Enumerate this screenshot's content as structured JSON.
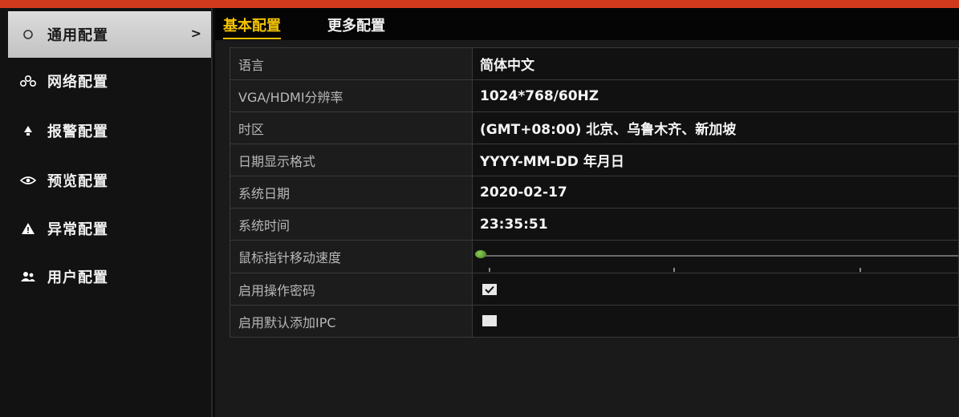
{
  "colors": {
    "accent": "#f2c200",
    "top_bar": "#d23a1e",
    "slider_knob": "#6cbf3a"
  },
  "sidebar": {
    "items": [
      {
        "label": "通用配置",
        "icon": "circle-icon",
        "active": true,
        "chevron": ">"
      },
      {
        "label": "网络配置",
        "icon": "network-icon"
      },
      {
        "label": "报警配置",
        "icon": "alarm-icon"
      },
      {
        "label": "预览配置",
        "icon": "eye-icon"
      },
      {
        "label": "异常配置",
        "icon": "warning-icon"
      },
      {
        "label": "用户配置",
        "icon": "users-icon"
      }
    ]
  },
  "tabs": [
    {
      "label": "基本配置",
      "active": true
    },
    {
      "label": "更多配置",
      "active": false
    }
  ],
  "settings": [
    {
      "label": "语言",
      "value": "简体中文"
    },
    {
      "label": "VGA/HDMI分辨率",
      "value": "1024*768/60HZ"
    },
    {
      "label": "时区",
      "value": "(GMT+08:00) 北京、乌鲁木齐、新加坡"
    },
    {
      "label": "日期显示格式",
      "value": "YYYY-MM-DD 年月日"
    },
    {
      "label": "系统日期",
      "value": "2020-02-17"
    },
    {
      "label": "系统时间",
      "value": "23:35:51"
    },
    {
      "label": "鼠标指针移动速度",
      "slider_value": 0
    },
    {
      "label": "启用操作密码",
      "checked": true
    },
    {
      "label": "启用默认添加IPC",
      "checked": false
    }
  ]
}
